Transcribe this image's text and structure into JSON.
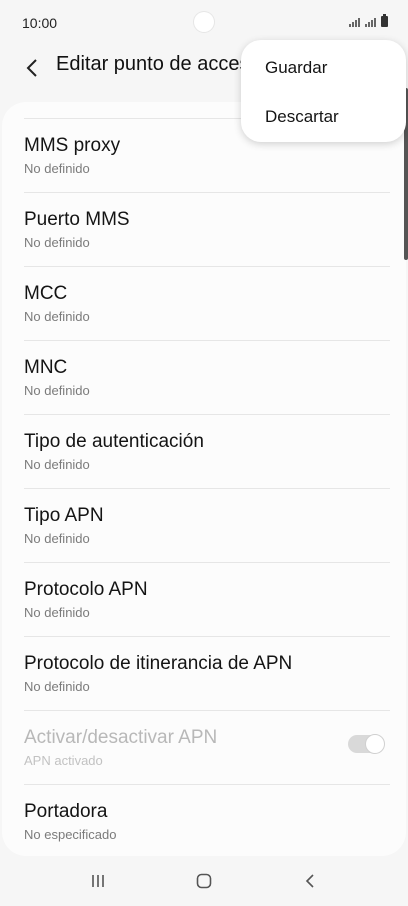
{
  "status_bar": {
    "time": "10:00"
  },
  "app_bar": {
    "title": "Editar punto de acceso"
  },
  "menu": {
    "items": [
      "Guardar",
      "Descartar"
    ]
  },
  "rows": [
    {
      "title": "MMS proxy",
      "subtitle": "No definido"
    },
    {
      "title": "Puerto MMS",
      "subtitle": "No definido"
    },
    {
      "title": "MCC",
      "subtitle": "No definido"
    },
    {
      "title": "MNC",
      "subtitle": "No definido"
    },
    {
      "title": "Tipo de autenticación",
      "subtitle": "No definido"
    },
    {
      "title": "Tipo APN",
      "subtitle": "No definido"
    },
    {
      "title": "Protocolo APN",
      "subtitle": "No definido"
    },
    {
      "title": "Protocolo de itinerancia de APN",
      "subtitle": "No definido"
    },
    {
      "title": "Activar/desactivar APN",
      "subtitle": "APN activado",
      "disabled": true,
      "toggle_on": true
    },
    {
      "title": "Portadora",
      "subtitle": "No especificado"
    }
  ]
}
